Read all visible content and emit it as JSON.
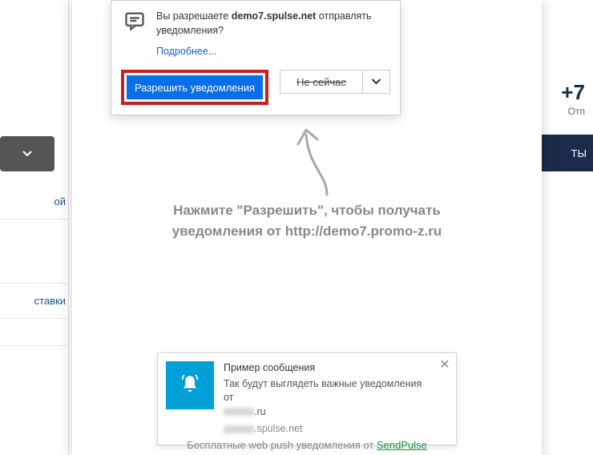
{
  "background": {
    "sidebar_items": [
      "ой",
      "",
      "ставки",
      ""
    ],
    "header_tab": "ТЫ",
    "phone": "+7",
    "phone_sub": "Отп"
  },
  "permission_prompt": {
    "text_prefix": "Вы разрешаете ",
    "domain": "demo7.spulse.net",
    "text_suffix": " отправлять уведомления?",
    "more_link": "Подробнее...",
    "allow_button": "Разрешить уведомления",
    "later_button": "Не сейчас"
  },
  "instruction": {
    "line1": "Нажмите \"Разрешить\", чтобы получать",
    "line2": "уведомления от http://demo7.promo-z.ru"
  },
  "sample_toast": {
    "title": "Пример сообщения",
    "body_prefix": "Так будут выглядеть важные уведомления от",
    "body_suffix": ".ru",
    "sender_suffix": ".spulse.net"
  },
  "footer": {
    "text": "Бесплатные web push уведомления от ",
    "link": "SendPulse"
  }
}
